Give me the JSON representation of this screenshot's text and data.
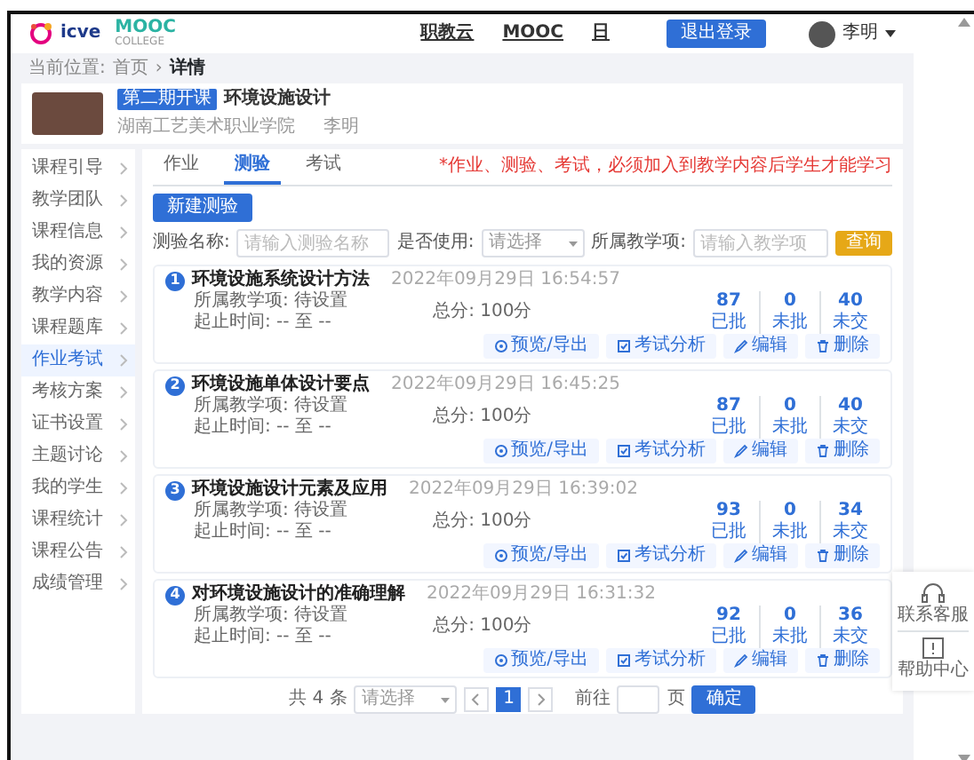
{
  "header": {
    "logo": {
      "brand": "icve",
      "mooc": "MOOC",
      "college": "COLLEGE"
    },
    "nav": [
      {
        "label": "职教云"
      },
      {
        "label": "MOOC"
      },
      {
        "label": "日"
      }
    ],
    "logout": "退出登录",
    "user": "李明"
  },
  "breadcrumb": {
    "label": "当前位置:",
    "items": [
      {
        "label": "首页"
      },
      {
        "label": "详情"
      }
    ],
    "separator": "›"
  },
  "course": {
    "badge": "第二期开课",
    "title": "环境设施设计",
    "school": "湖南工艺美术职业学院",
    "teacher": "李明"
  },
  "sidebar": {
    "items": [
      {
        "label": "课程引导",
        "selected": false
      },
      {
        "label": "教学团队",
        "selected": false
      },
      {
        "label": "课程信息",
        "selected": false
      },
      {
        "label": "我的资源",
        "selected": false
      },
      {
        "label": "教学内容",
        "selected": false
      },
      {
        "label": "课程题库",
        "selected": false
      },
      {
        "label": "作业考试",
        "selected": true
      },
      {
        "label": "考核方案",
        "selected": false
      },
      {
        "label": "证书设置",
        "selected": false
      },
      {
        "label": "主题讨论",
        "selected": false
      },
      {
        "label": "我的学生",
        "selected": false
      },
      {
        "label": "课程统计",
        "selected": false
      },
      {
        "label": "课程公告",
        "selected": false
      },
      {
        "label": "成绩管理",
        "selected": false
      }
    ]
  },
  "tabs": [
    {
      "label": "作业",
      "selected": false
    },
    {
      "label": "测验",
      "selected": true
    },
    {
      "label": "考试",
      "selected": false
    }
  ],
  "notice": "*作业、测验、考试，必须加入到教学内容后学生才能学习",
  "new_button": "新建测验",
  "filters": [
    {
      "label": "测验名称:",
      "kind": "input",
      "placeholder": "请输入测验名称"
    },
    {
      "label": "是否使用:",
      "kind": "select",
      "placeholder": "请选择"
    },
    {
      "label": "所属教学项:",
      "kind": "input",
      "placeholder": "请输入教学项"
    }
  ],
  "search_button": "查询",
  "quizzes": [
    {
      "number": "1",
      "title": "环境设施系统设计方法",
      "date": "2022年09月29日 16:54:57",
      "teaching_item": "所属教学项: 待设置",
      "period": "起止时间: -- 至 --",
      "total": "总分: 100分",
      "stats": [
        {
          "value": "87",
          "label": "已批"
        },
        {
          "value": "0",
          "label": "未批"
        },
        {
          "value": "40",
          "label": "未交"
        }
      ],
      "actions": [
        {
          "label": "预览/导出",
          "kind": "preview"
        },
        {
          "label": "考试分析",
          "kind": "analysis"
        },
        {
          "label": "编辑",
          "kind": "edit"
        },
        {
          "label": "删除",
          "kind": "delete"
        }
      ]
    },
    {
      "number": "2",
      "title": "环境设施单体设计要点",
      "date": "2022年09月29日 16:45:25",
      "teaching_item": "所属教学项: 待设置",
      "period": "起止时间: -- 至 --",
      "total": "总分: 100分",
      "stats": [
        {
          "value": "87",
          "label": "已批"
        },
        {
          "value": "0",
          "label": "未批"
        },
        {
          "value": "40",
          "label": "未交"
        }
      ],
      "actions": [
        {
          "label": "预览/导出",
          "kind": "preview"
        },
        {
          "label": "考试分析",
          "kind": "analysis"
        },
        {
          "label": "编辑",
          "kind": "edit"
        },
        {
          "label": "删除",
          "kind": "delete"
        }
      ]
    },
    {
      "number": "3",
      "title": "环境设施设计元素及应用",
      "date": "2022年09月29日 16:39:02",
      "teaching_item": "所属教学项: 待设置",
      "period": "起止时间: -- 至 --",
      "total": "总分: 100分",
      "stats": [
        {
          "value": "93",
          "label": "已批"
        },
        {
          "value": "0",
          "label": "未批"
        },
        {
          "value": "34",
          "label": "未交"
        }
      ],
      "actions": [
        {
          "label": "预览/导出",
          "kind": "preview"
        },
        {
          "label": "考试分析",
          "kind": "analysis"
        },
        {
          "label": "编辑",
          "kind": "edit"
        },
        {
          "label": "删除",
          "kind": "delete"
        }
      ]
    },
    {
      "number": "4",
      "title": "对环境设施设计的准确理解",
      "date": "2022年09月29日 16:31:32",
      "teaching_item": "所属教学项: 待设置",
      "period": "起止时间: -- 至 --",
      "total": "总分: 100分",
      "stats": [
        {
          "value": "92",
          "label": "已批"
        },
        {
          "value": "0",
          "label": "未批"
        },
        {
          "value": "36",
          "label": "未交"
        }
      ],
      "actions": [
        {
          "label": "预览/导出",
          "kind": "preview"
        },
        {
          "label": "考试分析",
          "kind": "analysis"
        },
        {
          "label": "编辑",
          "kind": "edit"
        },
        {
          "label": "删除",
          "kind": "delete"
        }
      ]
    }
  ],
  "pagination": {
    "total": "共 4 条",
    "page_size": "请选择",
    "pages": [
      {
        "label": "1",
        "selected": true
      }
    ],
    "goto": "前往",
    "unit": "页",
    "confirm": "确定"
  },
  "float_panel": [
    {
      "label": "联系客服",
      "kind": "headset"
    },
    {
      "label": "帮助中心",
      "kind": "help"
    }
  ]
}
